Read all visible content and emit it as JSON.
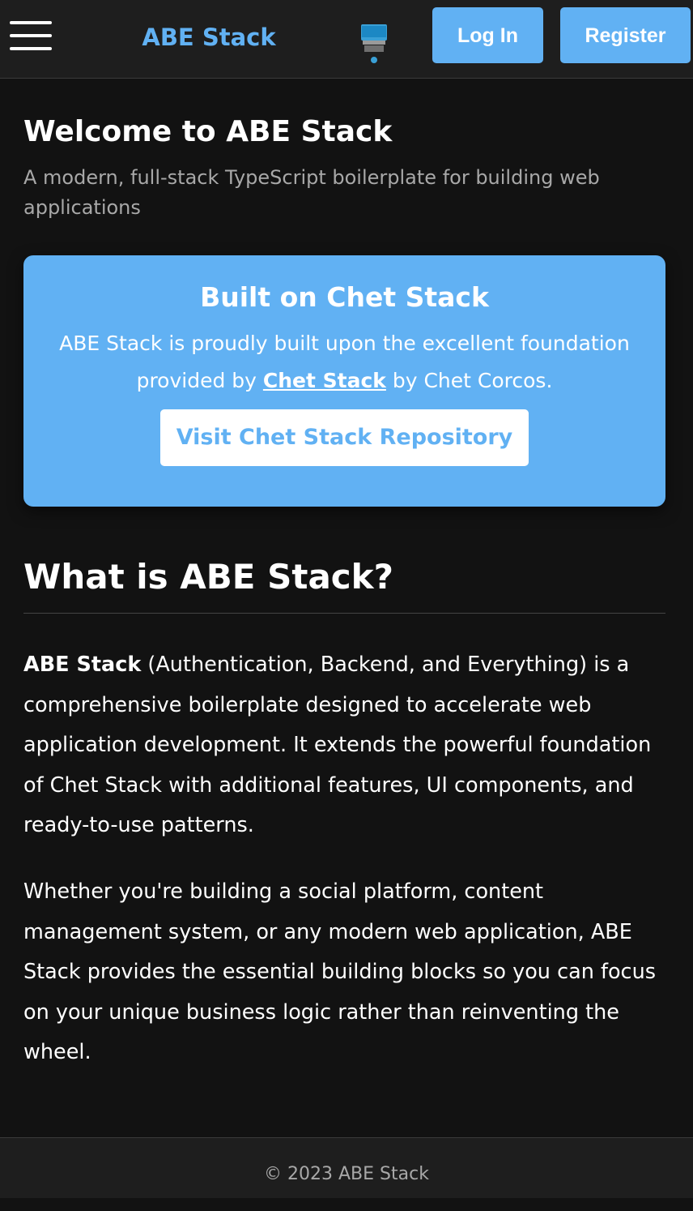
{
  "header": {
    "menu_icon": "hamburger-menu-icon",
    "brand": "ABE Stack",
    "theme_icon": "monitor-theme-icon",
    "login_label": "Log In",
    "register_label": "Register"
  },
  "welcome": {
    "title": "Welcome to ABE Stack",
    "subtitle": "A modern, full-stack TypeScript boilerplate for building web applications"
  },
  "card": {
    "title": "Built on Chet Stack",
    "text_before": "ABE Stack is proudly built upon the excellent foundation provided by ",
    "link": "Chet Stack",
    "text_after": " by Chet Corcos.",
    "button": "Visit Chet Stack Repository"
  },
  "about": {
    "title": "What is ABE Stack?",
    "p1_bold": "ABE Stack",
    "p1_rest": " (Authentication, Backend, and Everything) is a comprehensive boilerplate designed to accelerate web application development. It extends the powerful foundation of Chet Stack with additional features, UI components, and ready-to-use patterns.",
    "p2": "Whether you're building a social platform, content management system, or any modern web application, ABE Stack provides the essential building blocks so you can focus on your unique business logic rather than reinventing the wheel."
  },
  "footer": {
    "text": "© 2023 ABE Stack"
  },
  "colors": {
    "accent": "#61b1f3",
    "background": "#121212",
    "surface": "#1e1e1e"
  }
}
